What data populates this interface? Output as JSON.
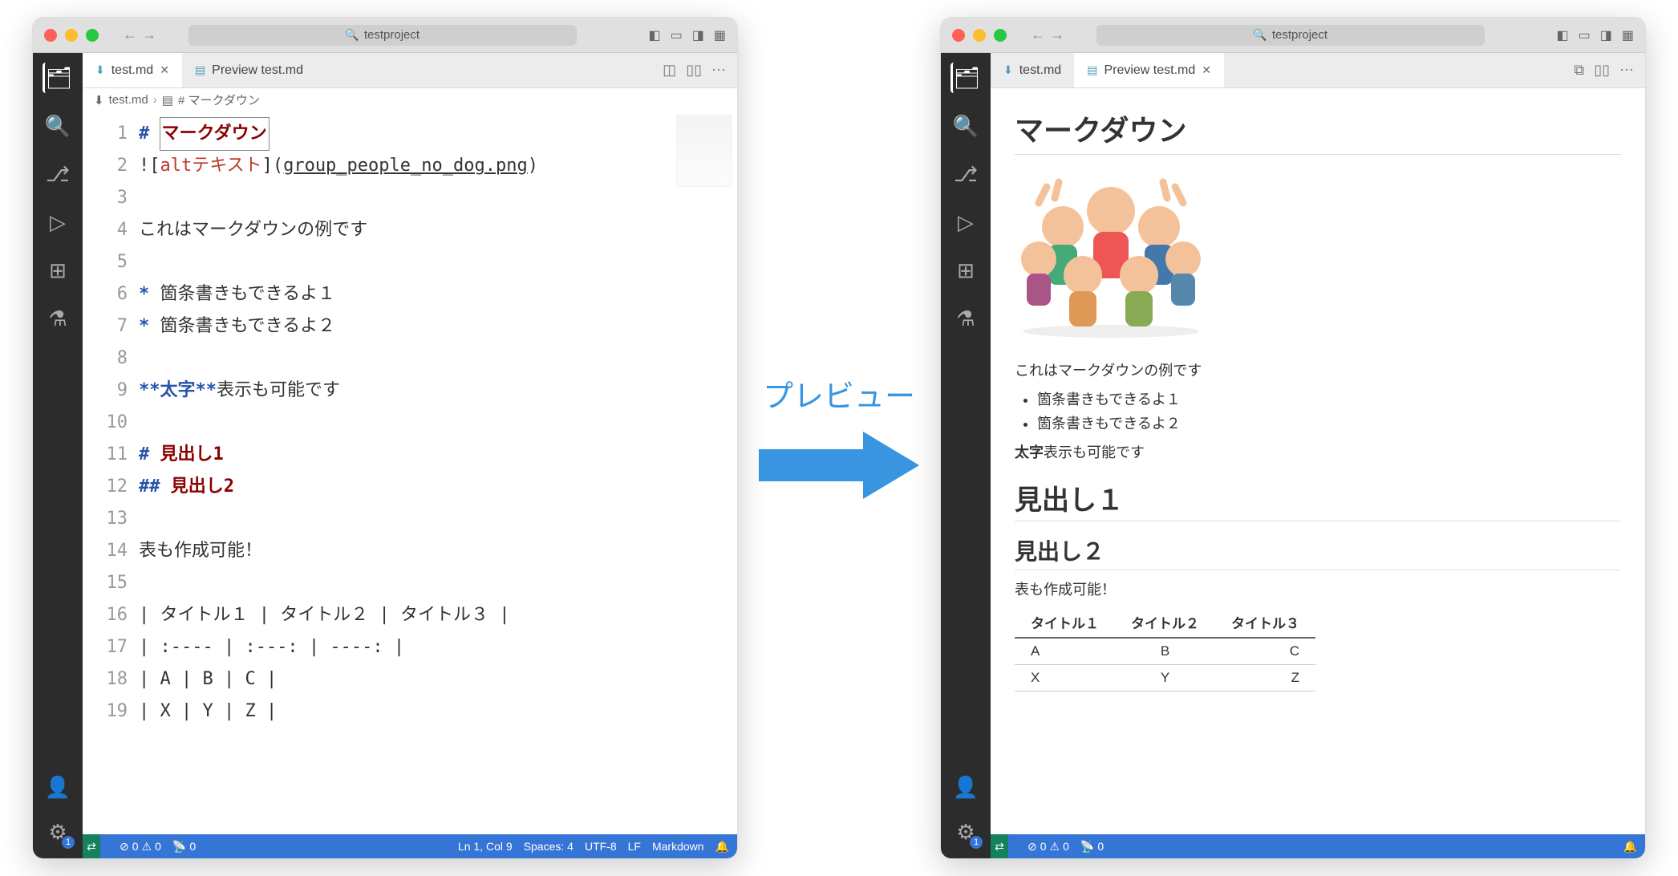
{
  "titlebar": {
    "project": "testproject"
  },
  "left": {
    "tabs": [
      {
        "label": "test.md",
        "active": true,
        "closable": true
      },
      {
        "label": "Preview test.md",
        "active": false,
        "closable": false
      }
    ],
    "breadcrumb": {
      "file": "test.md",
      "heading": "# マークダウン"
    },
    "editor_lines": [
      "# マークダウン",
      "![altテキスト](group_people_no_dog.png)",
      "",
      "これはマークダウンの例です",
      "",
      "* 箇条書きもできるよ１",
      "* 箇条書きもできるよ２",
      "",
      "**太字**表示も可能です",
      "",
      "# 見出し1",
      "## 見出し2",
      "",
      "表も作成可能！",
      "",
      "| タイトル１ | タイトル２ | タイトル３ |",
      "| :---- | :---: | ----: |",
      "| A | B | C |",
      "| X | Y | Z |"
    ],
    "line_count": 19,
    "statusbar": {
      "errors": "0",
      "warnings": "0",
      "radio": "0",
      "cursor": "Ln 1, Col 9",
      "spaces": "Spaces: 4",
      "encoding": "UTF-8",
      "eol": "LF",
      "lang": "Markdown"
    }
  },
  "right": {
    "tabs": [
      {
        "label": "test.md",
        "active": false,
        "closable": false
      },
      {
        "label": "Preview test.md",
        "active": true,
        "closable": true
      }
    ],
    "preview": {
      "h1": "マークダウン",
      "image_alt": "altテキスト",
      "p1": "これはマークダウンの例です",
      "bullets": [
        "箇条書きもできるよ１",
        "箇条書きもできるよ２"
      ],
      "bold": "太字",
      "bold_after": "表示も可能です",
      "h1_2": "見出し１",
      "h2": "見出し２",
      "p_table": "表も作成可能！",
      "table_headers": [
        "タイトル１",
        "タイトル２",
        "タイトル３"
      ],
      "table_rows": [
        [
          "A",
          "B",
          "C"
        ],
        [
          "X",
          "Y",
          "Z"
        ]
      ]
    },
    "statusbar": {
      "errors": "0",
      "warnings": "0",
      "radio": "0"
    }
  },
  "center_label": "プレビュー",
  "colors": {
    "accent": "#3575d5",
    "arrow": "#3a95e0"
  }
}
